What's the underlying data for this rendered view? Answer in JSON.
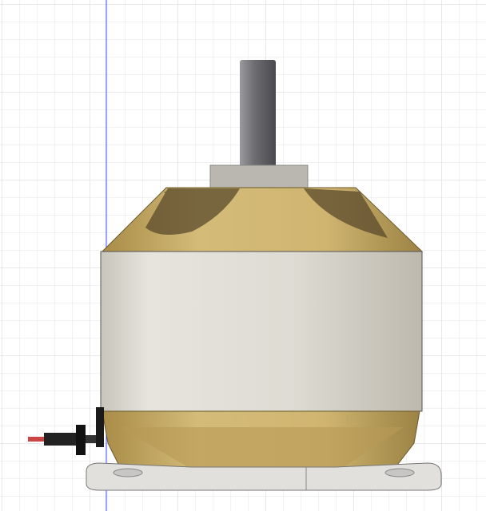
{
  "viewport": {
    "background": "#ffffff",
    "grid_minor": "#e6e6ea",
    "grid_major": "#d2d2d8",
    "axis_color": "#3a4cff"
  },
  "model": {
    "shaft_color": "#6e6e72",
    "can_color": "#dcd9d0",
    "gold_color": "#c9ae6a",
    "mount_color": "#e2e0dc"
  }
}
